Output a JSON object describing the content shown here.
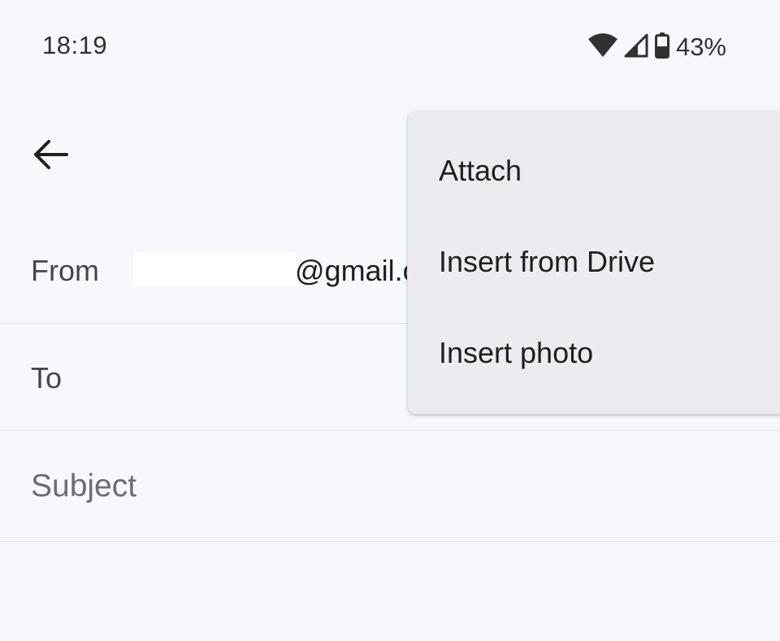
{
  "status_bar": {
    "time": "18:19",
    "battery": "43%",
    "icons": [
      "wifi-icon",
      "cell-signal-icon",
      "battery-icon"
    ]
  },
  "compose": {
    "back_icon": "arrow-back-icon",
    "from_label": "From",
    "from_value": "@gmail.c",
    "to_label": "To",
    "subject_placeholder": "Subject"
  },
  "menu": {
    "items": [
      {
        "label": "Attach"
      },
      {
        "label": "Insert from Drive"
      },
      {
        "label": "Insert photo"
      }
    ]
  },
  "colors": {
    "background": "#f7f8fc",
    "menu_background": "#ececf0",
    "divider": "#e3e4e8"
  }
}
